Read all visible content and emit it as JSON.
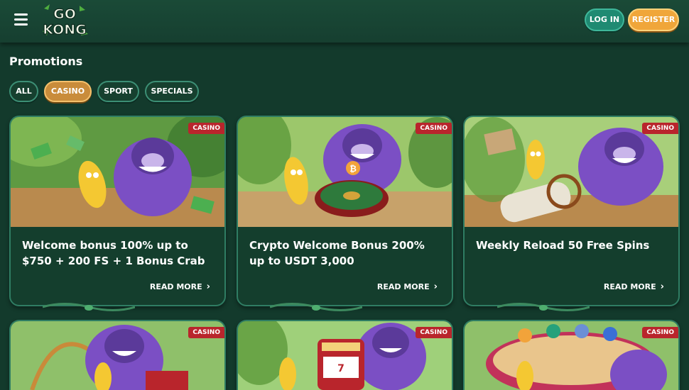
{
  "header": {
    "logo_top": "GO",
    "logo_bottom": "KONG",
    "login_label": "LOG IN",
    "register_label": "REGISTER"
  },
  "page": {
    "title": "Promotions"
  },
  "filters": [
    {
      "label": "ALL",
      "active": false
    },
    {
      "label": "CASINO",
      "active": true
    },
    {
      "label": "SPORT",
      "active": false
    },
    {
      "label": "SPECIALS",
      "active": false
    }
  ],
  "cards": [
    {
      "tag": "CASINO",
      "title": "Welcome bonus 100% up to $750 + 200 FS + 1 Bonus Crab",
      "more": "READ MORE"
    },
    {
      "tag": "CASINO",
      "title": "Crypto Welcome Bonus 200% up to USDT 3,000",
      "more": "READ MORE"
    },
    {
      "tag": "CASINO",
      "title": "Weekly Reload 50 Free Spins",
      "more": "READ MORE"
    },
    {
      "tag": "CASINO"
    },
    {
      "tag": "CASINO"
    },
    {
      "tag": "CASINO"
    }
  ],
  "colors": {
    "background": "#133a2c",
    "accent_green": "#1f8a72",
    "accent_orange": "#f0a63a",
    "tag_red": "#b9252c",
    "gorilla_purple": "#7b4fc4"
  }
}
